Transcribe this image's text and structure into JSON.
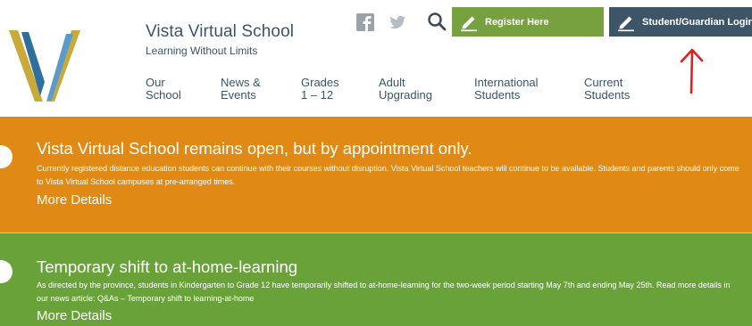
{
  "header": {
    "site_name": "Vista Virtual School",
    "tagline": "Learning Without Limits",
    "logo_icon": "v-logo-icon",
    "social": [
      {
        "icon": "facebook-icon"
      },
      {
        "icon": "twitter-icon"
      }
    ],
    "search_icon": "search-icon",
    "register_label": "Register Here",
    "login_label": "Student/Guardian Login",
    "colors": {
      "register_bg": "#76a13e",
      "login_bg": "#3e5568",
      "text": "#3a5468"
    }
  },
  "nav": [
    {
      "line1": "Our",
      "line2": "School"
    },
    {
      "line1": "News &",
      "line2": "Events"
    },
    {
      "line1": "Grades",
      "line2": "1 – 12"
    },
    {
      "line1": "Adult",
      "line2": "Upgrading"
    },
    {
      "line1": "International",
      "line2": "Students"
    },
    {
      "line1": "Current",
      "line2": "Students"
    }
  ],
  "annotation": {
    "icon": "red-arrow-icon",
    "color": "#e02020"
  },
  "banners": [
    {
      "title": "Vista Virtual School remains open, but by appointment only.",
      "body": "Currently registered distance education students can continue with their courses without disruption. Vista Virtual School teachers will continue to be available. Students and parents should only come to Vista Virtual School campuses at pre-arranged times.",
      "link": "More Details",
      "color": "#e08a15"
    },
    {
      "title": "Temporary shift to at-home-learning",
      "body": "As directed by the province, students in Kindergarten to Grade 12 have temporarily shifted to at-home-learning for the two-week period starting May 7th and ending May 25th. Read more details in our news article: Q&As – Temporary shift to learning-at-home",
      "link": "More Details",
      "color": "#6aa23a"
    }
  ]
}
